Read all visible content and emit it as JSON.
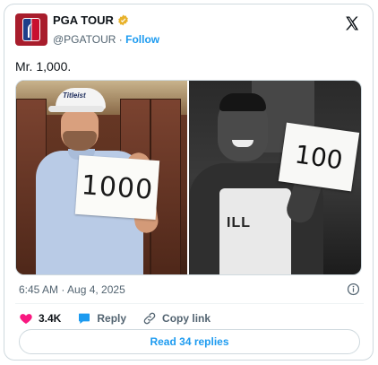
{
  "author": {
    "display_name": "PGA TOUR",
    "handle": "@PGATOUR",
    "separator": "·",
    "follow_label": "Follow",
    "verified_color": "#e8b22b"
  },
  "tweet": {
    "text": "Mr. 1,000.",
    "timestamp": "6:45 AM · Aug 4, 2025"
  },
  "media": {
    "left_sign_text": "1000",
    "left_cap_text": "Titleist",
    "right_sign_text": "100",
    "right_jersey_text": "ILL"
  },
  "actions": {
    "likes_count": "3.4K",
    "reply_label": "Reply",
    "copy_link_label": "Copy link"
  },
  "read_replies_label": "Read 34 replies",
  "colors": {
    "accent": "#1d9bf0",
    "like": "#f91880",
    "muted": "#536471"
  }
}
